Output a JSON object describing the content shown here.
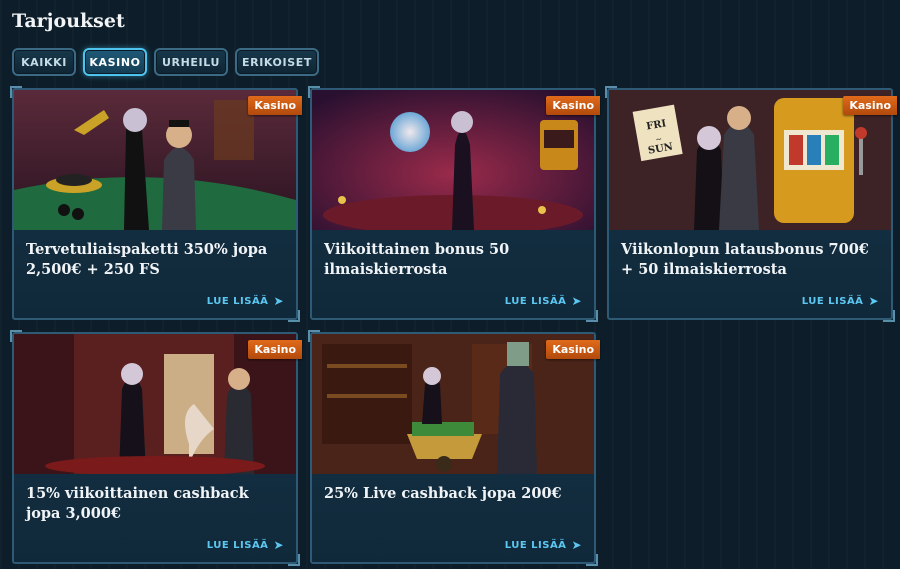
{
  "page": {
    "title": "Tarjoukset"
  },
  "tabs": [
    {
      "label": "KAIKKI",
      "active": false
    },
    {
      "label": "KASINO",
      "active": true
    },
    {
      "label": "URHEILU",
      "active": false
    },
    {
      "label": "ERIKOISET",
      "active": false
    }
  ],
  "cards": [
    {
      "badge": "Kasino",
      "title": "Tervetuliaispaketti 350% jopa 2,500€ + 250 FS",
      "link": "LUE LISÄÄ",
      "image": "casino-table-couple"
    },
    {
      "badge": "Kasino",
      "title": "Viikoittainen bonus 50 ilmaiskierrosta",
      "link": "LUE LISÄÄ",
      "image": "spinning-orb-woman"
    },
    {
      "badge": "Kasino",
      "title": "Viikonlopun latausbonus 700€ + 50 ilmaiskierrosta",
      "link": "LUE LISÄÄ",
      "image": "slot-machine-couple",
      "image_sign": "FRI SUN"
    },
    {
      "badge": "Kasino",
      "title": "15% viikoittainen cashback jopa 3,000€",
      "link": "LUE LISÄÄ",
      "image": "hand-from-door"
    },
    {
      "badge": "Kasino",
      "title": "25% Live cashback jopa 200€",
      "link": "LUE LISÄÄ",
      "image": "money-wheelbarrow"
    }
  ],
  "colors": {
    "accent": "#4ec3ee",
    "badge": "#d95f16",
    "link": "#5cc8f2",
    "background": "#0d1e2a"
  }
}
